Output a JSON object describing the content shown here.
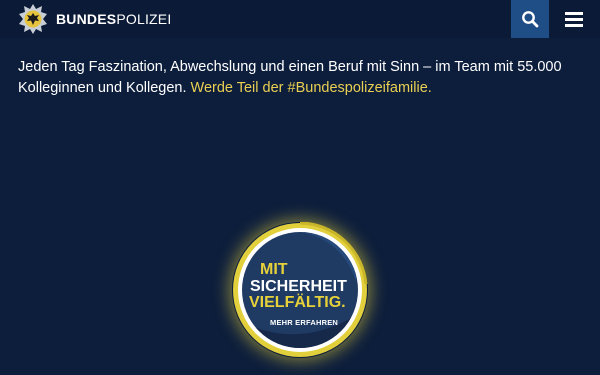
{
  "header": {
    "brand_bold": "BUNDES",
    "brand_regular": "POLIZEI",
    "logo_icon": "eagle-star-icon",
    "search_icon": "search-icon",
    "menu_icon": "hamburger-menu-icon"
  },
  "intro": {
    "text": "Jeden Tag Faszination, Abwechslung und einen Beruf mit Sinn – im Team mit 55.000 Kolleginnen und Kollegen.",
    "cta": "Werde Teil der #Bundespolizeifamilie."
  },
  "badge": {
    "line1": "MIT",
    "line2": "SICHERHEIT",
    "line3": "VIELFÄLTIG.",
    "link": "MEHR ERFAHREN"
  },
  "colors": {
    "background": "#0d1e3c",
    "accent_yellow": "#e6d13a",
    "search_button": "#1f4e86"
  }
}
